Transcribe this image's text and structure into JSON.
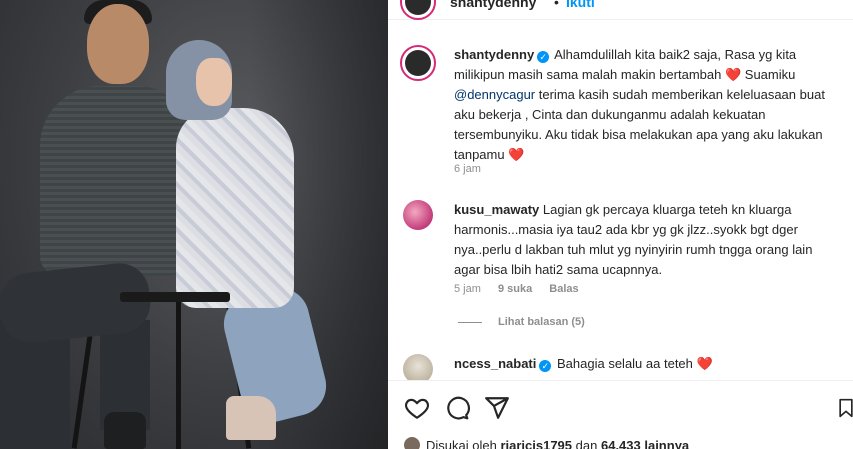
{
  "post": {
    "author": "shantydenny",
    "follow_dot": "•",
    "follow_label": "Ikuti"
  },
  "caption": {
    "user": "shantydenny",
    "text_1": "Alhamdulillah kita baik2 saja, Rasa yg kita milikipun masih sama malah makin bertambah",
    "heart": "❤️",
    "text_2": "Suamiku",
    "mention": "@dennycagur",
    "text_3": "terima kasih sudah memberikan keleluasaan buat aku bekerja , Cinta dan dukunganmu adalah kekuatan tersembunyiku. Aku tidak bisa melakukan apa yang aku lakukan tanpamu",
    "heart_end": "❤️",
    "time": "6 jam"
  },
  "comments": [
    {
      "user": "kusu_mawaty",
      "text": "Lagian gk percaya kluarga teteh kn kluarga harmonis...masia iya tau2 ada kbr yg gk jlzz..syokk bgt dger nya..perlu d lakban tuh mlut yg nyinyirin rumh tngga orang lain agar bisa lbih hati2 sama ucapnnya.",
      "time": "5 jam",
      "likes": "9 suka",
      "reply": "Balas",
      "view_replies": "Lihat balasan (5)"
    },
    {
      "user": "ncess_nabati",
      "text": "Bahagia selalu aa teteh",
      "heart": "❤️"
    }
  ],
  "likes": {
    "prefix": "Disukai oleh",
    "user": "riaricis1795",
    "middle": "dan",
    "count": "64.433 lainnya"
  },
  "icons": {
    "like": "heart-outline-icon",
    "comment": "comment-bubble-icon",
    "share": "paper-plane-icon",
    "save": "bookmark-icon"
  },
  "colors": {
    "link": "#0095f6",
    "mention": "#00376b",
    "heart": "#ed4956",
    "muted": "#8e8e8e"
  }
}
